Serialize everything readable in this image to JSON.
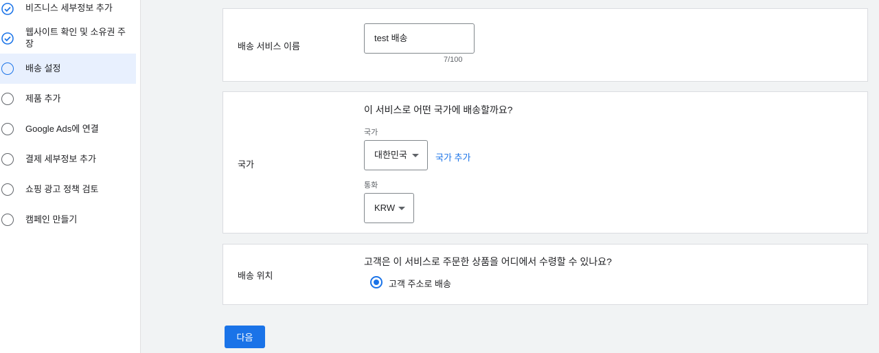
{
  "accent_color": "#1a73e8",
  "sidebar": {
    "steps": [
      {
        "label": "비즈니스 세부정보 추가",
        "status": "done",
        "icon": "check-circle-icon"
      },
      {
        "label": "웹사이트 확인 및 소유권 주장",
        "status": "done",
        "icon": "check-circle-icon"
      },
      {
        "label": "배송 설정",
        "status": "active",
        "icon": "circle-icon"
      },
      {
        "label": "제품 추가",
        "status": "todo",
        "icon": "circle-icon"
      },
      {
        "label": "Google Ads에 연결",
        "status": "todo",
        "icon": "circle-icon"
      },
      {
        "label": "결제 세부정보 추가",
        "status": "todo",
        "icon": "circle-icon"
      },
      {
        "label": "쇼핑 광고 정책 검토",
        "status": "todo",
        "icon": "circle-icon"
      },
      {
        "label": "캠페인 만들기",
        "status": "todo",
        "icon": "circle-icon"
      }
    ]
  },
  "service_name": {
    "label": "배송 서비스 이름",
    "value": "test 배송",
    "counter": "7/100"
  },
  "country": {
    "label": "국가",
    "question": "이 서비스로 어떤 국가에 배송할까요?",
    "country_field_label": "국가",
    "country_value": "대한민국",
    "add_country_link": "국가 추가",
    "currency_field_label": "통화",
    "currency_value": "KRW"
  },
  "delivery_location": {
    "label": "배송 위치",
    "question": "고객은 이 서비스로 주문한 상품을 어디에서 수령할 수 있나요?",
    "option_label": "고객 주소로 배송",
    "option_selected": true
  },
  "next_button": "다음"
}
